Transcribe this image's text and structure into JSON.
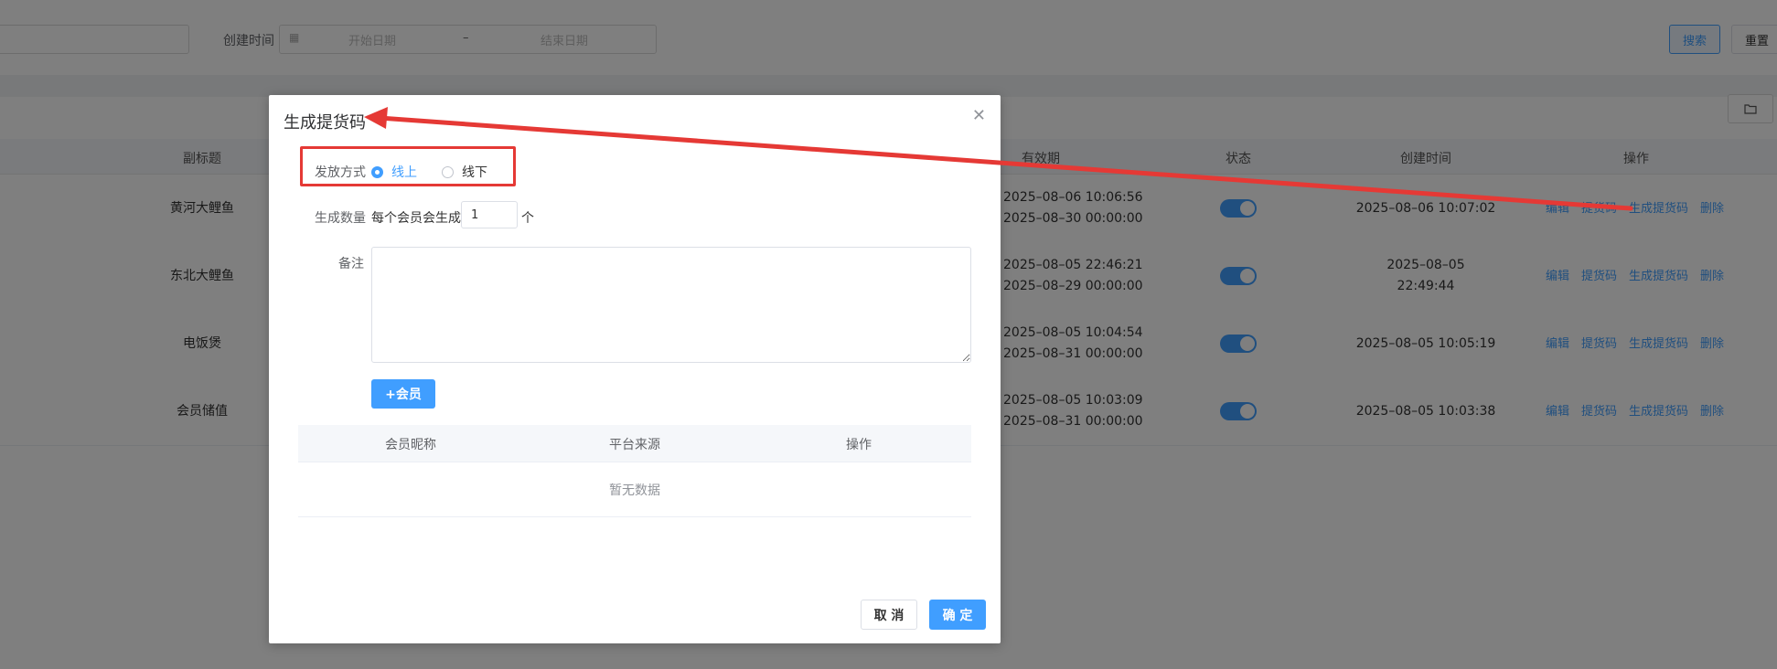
{
  "filters": {
    "created_time_label": "创建时间",
    "start_placeholder": "开始日期",
    "range_separator": "–",
    "end_placeholder": "结束日期",
    "search_button": "搜索",
    "reset_button": "重置",
    "calendar_icon": "calendar-icon"
  },
  "toolbar": {
    "folder_icon": "folder-icon"
  },
  "table": {
    "headers": {
      "subtitle": "副标题",
      "validity": "有效期",
      "status": "状态",
      "created": "创建时间",
      "ops": "操作"
    },
    "op_labels": {
      "edit": "编辑",
      "pickup_code": "提货码",
      "generate_code": "生成提货码",
      "delete": "删除"
    },
    "rows": [
      {
        "subtitle": "黄河大鲤鱼",
        "valid_start": "2025–08–06 10:06:56",
        "valid_end": "2025–08–30 00:00:00",
        "created_line1": "2025–08–06 10:07:02",
        "created_line2": "",
        "status_on": true
      },
      {
        "subtitle": "东北大鲤鱼",
        "valid_start": "2025–08–05 22:46:21",
        "valid_end": "2025–08–29 00:00:00",
        "created_line1": "2025–08–05",
        "created_line2": "22:49:44",
        "status_on": true
      },
      {
        "subtitle": "电饭煲",
        "valid_start": "2025–08–05 10:04:54",
        "valid_end": "2025–08–31 00:00:00",
        "created_line1": "2025–08–05 10:05:19",
        "created_line2": "",
        "status_on": true
      },
      {
        "subtitle": "会员储值",
        "valid_start": "2025–08–05 10:03:09",
        "valid_end": "2025–08–31 00:00:00",
        "created_line1": "2025–08–05 10:03:38",
        "created_line2": "",
        "status_on": true
      }
    ]
  },
  "dialog": {
    "title": "生成提货码",
    "close_icon": "close-icon",
    "method_label": "发放方式",
    "method_options": [
      "线上",
      "线下"
    ],
    "method_selected": "线上",
    "count_label": "生成数量",
    "count_prefix": "每个会员会生成",
    "count_value": "1",
    "count_suffix": "个",
    "remark_label": "备注",
    "remark_value": "",
    "add_member_button": "+会员",
    "members_table": {
      "headers": [
        "会员昵称",
        "平台来源",
        "操作"
      ],
      "empty_text": "暂无数据"
    },
    "cancel_button": "取 消",
    "confirm_button": "确 定"
  },
  "annotation": {
    "color": "#e53935"
  },
  "colors": {
    "primary": "#409eff",
    "overlay": "rgba(0,0,0,0.5)"
  }
}
